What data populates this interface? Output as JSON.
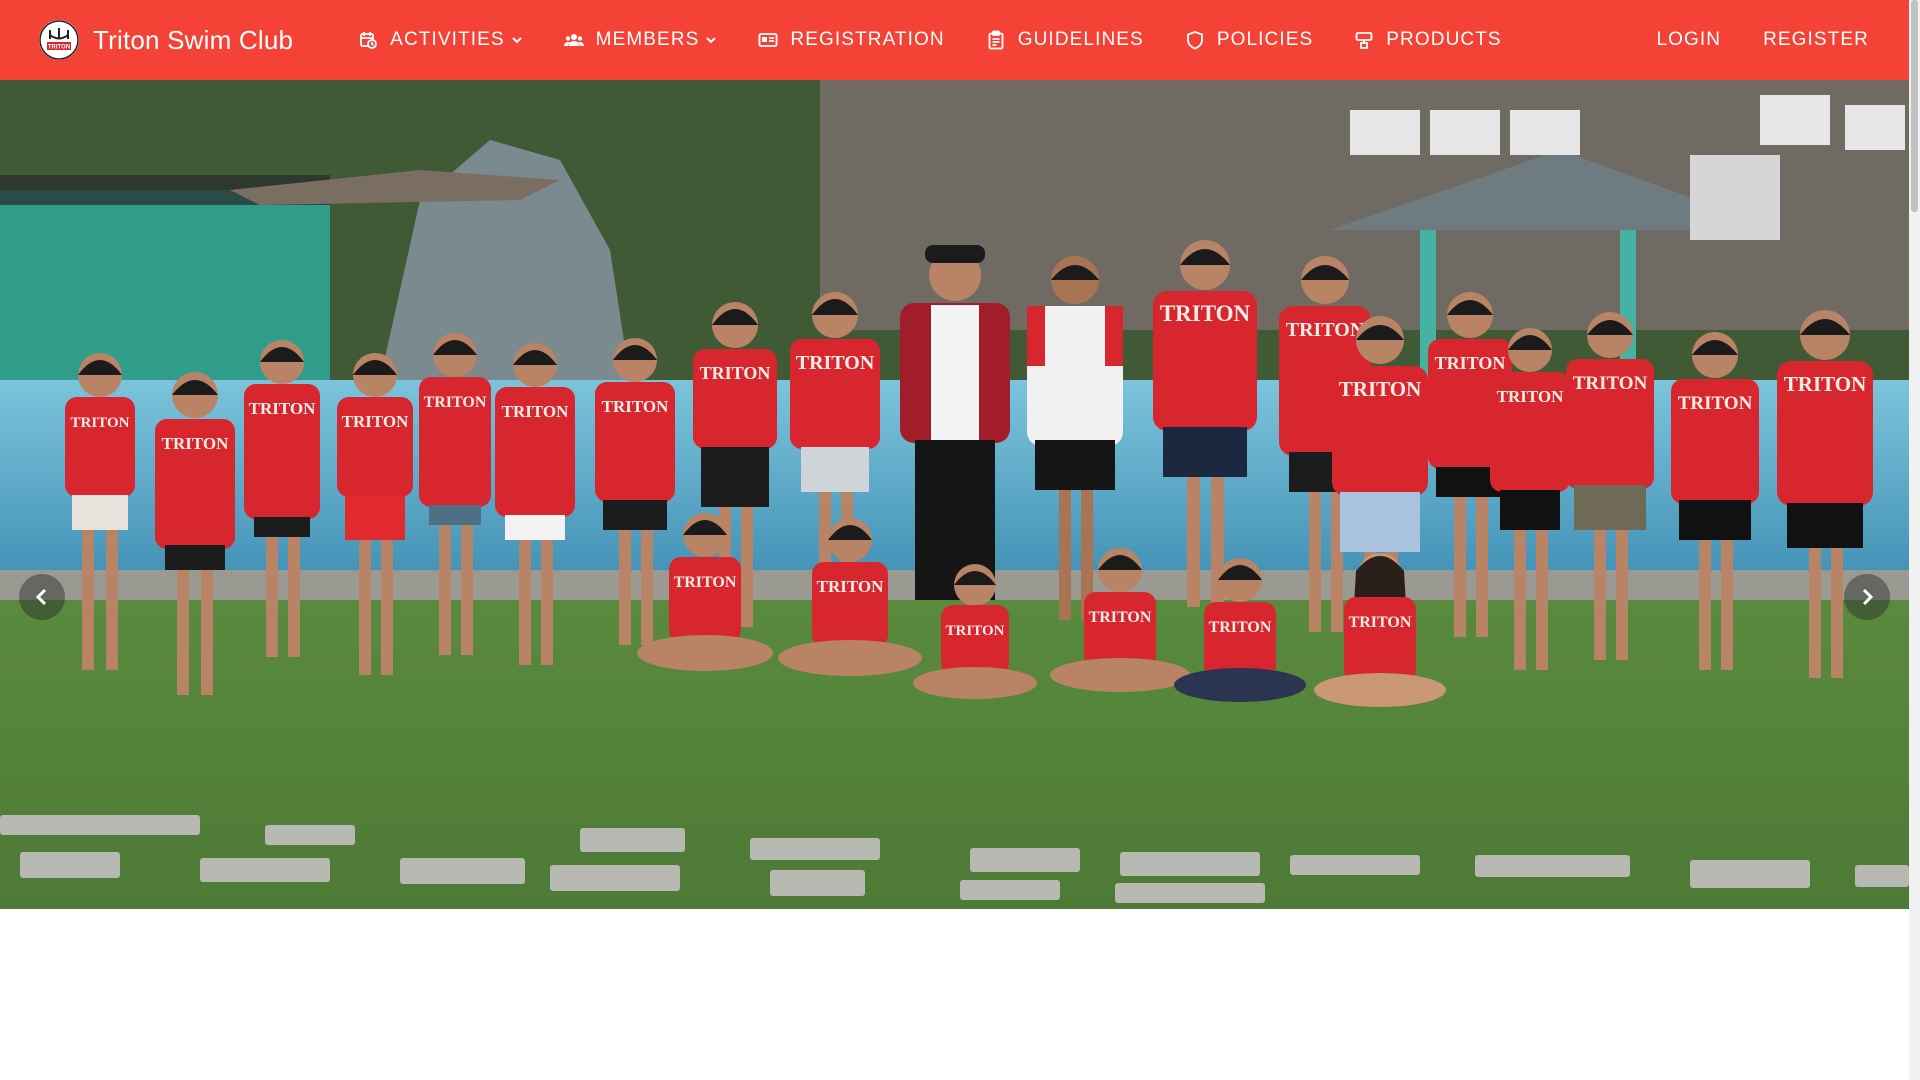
{
  "brand": {
    "name": "Triton Swim Club",
    "logo_text": "TRITON"
  },
  "nav": {
    "items": [
      {
        "label": "ACTIVITIES",
        "icon": "calendar-clock-icon",
        "dropdown": true
      },
      {
        "label": "MEMBERS",
        "icon": "users-icon",
        "dropdown": true
      },
      {
        "label": "REGISTRATION",
        "icon": "id-card-icon",
        "dropdown": false
      },
      {
        "label": "GUIDELINES",
        "icon": "clipboard-icon",
        "dropdown": false
      },
      {
        "label": "POLICIES",
        "icon": "shield-icon",
        "dropdown": false
      },
      {
        "label": "PRODUCTS",
        "icon": "shirt-icon",
        "dropdown": false
      }
    ],
    "login": "LOGIN",
    "register": "REGISTER"
  },
  "hero": {
    "shirt_text": "TRITON",
    "prev_icon": "chevron-left-icon",
    "next_icon": "chevron-right-icon"
  },
  "colors": {
    "navbar": "#f44336",
    "shirt": "#d8262e",
    "grass": "#5f8a45",
    "pool": "#5aa9c9"
  }
}
